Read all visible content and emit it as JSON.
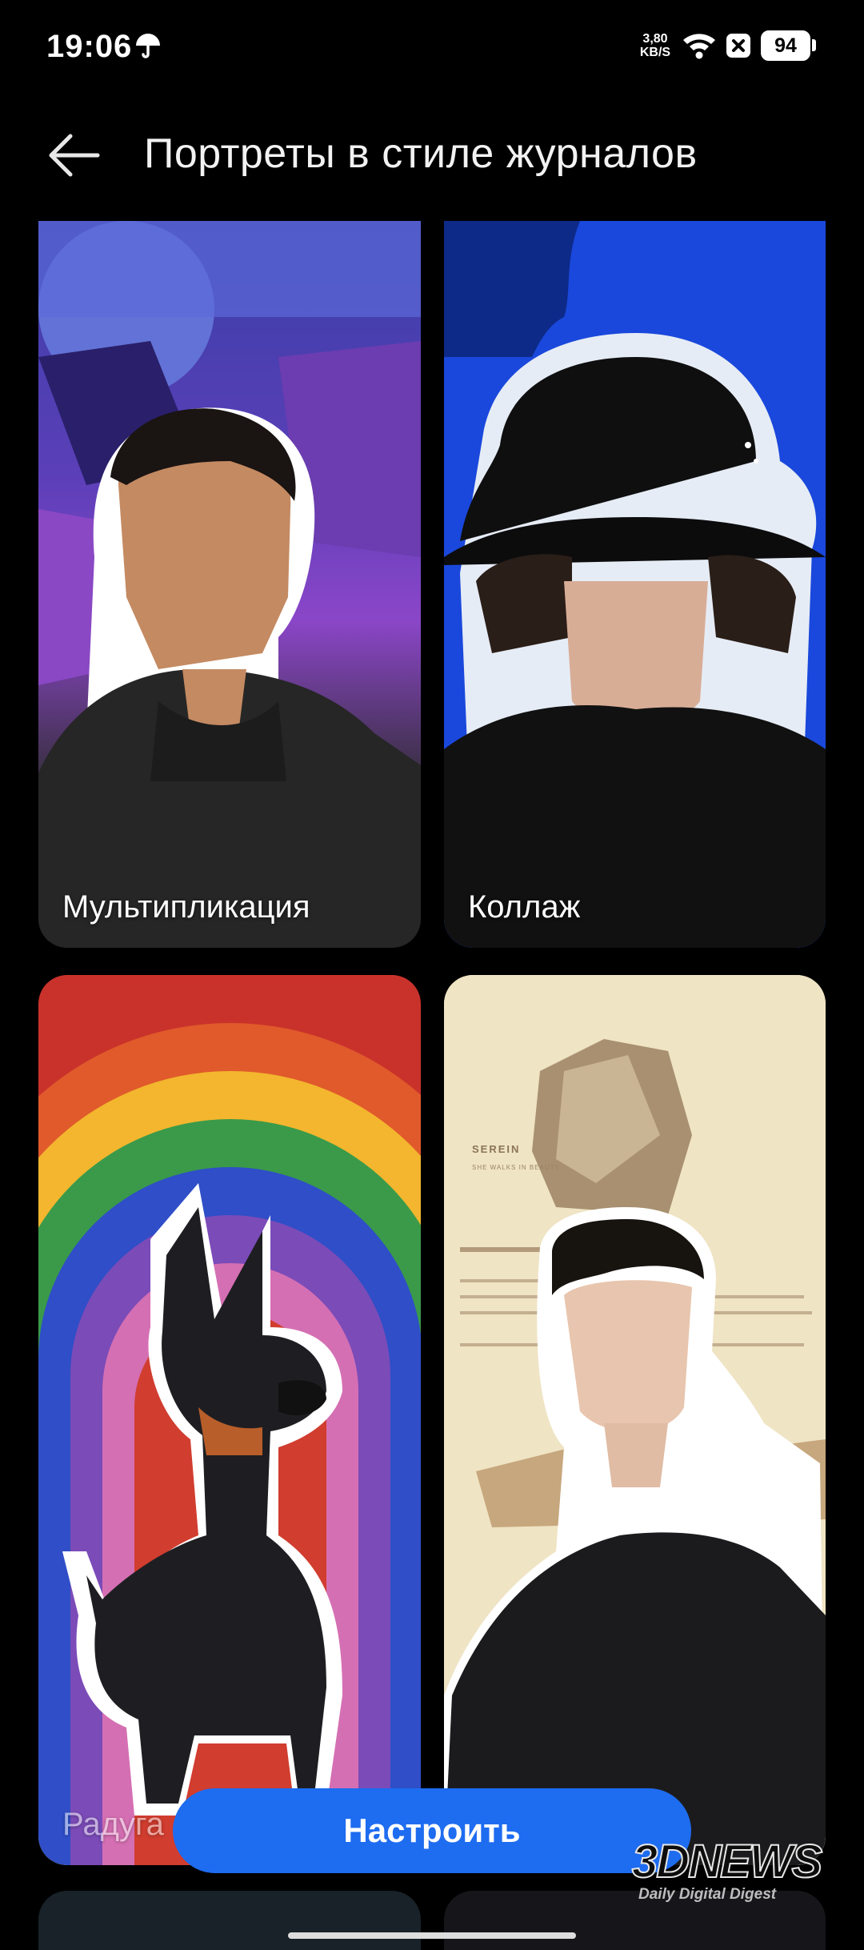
{
  "status_bar": {
    "time": "19:06",
    "net_speed_value": "3,80",
    "net_speed_unit": "KB/S",
    "battery": "94",
    "icons": [
      "umbrella-icon",
      "wifi-icon",
      "sim-blocked-icon",
      "battery-icon"
    ]
  },
  "header": {
    "back_icon": "arrow-left-icon",
    "title": "Портреты в стиле журналов"
  },
  "styles": [
    {
      "label": "Мультипликация",
      "image": "cartoon-portrait-young-man"
    },
    {
      "label": "Коллаж",
      "image": "collage-portrait-cap"
    },
    {
      "label": "Радуга",
      "image": "rainbow-dog-cartoon"
    },
    {
      "label": "",
      "image": "magazine-portrait-rock"
    }
  ],
  "magazine_text": {
    "heading": "SEREIN",
    "subheading": "SHE WALKS IN BEAUTY"
  },
  "action": {
    "customize_label": "Настроить"
  },
  "watermark": {
    "brand": "3DNEWS",
    "tagline": "Daily Digital Digest"
  },
  "colors": {
    "accent": "#1e6cf0",
    "background": "#000000"
  }
}
